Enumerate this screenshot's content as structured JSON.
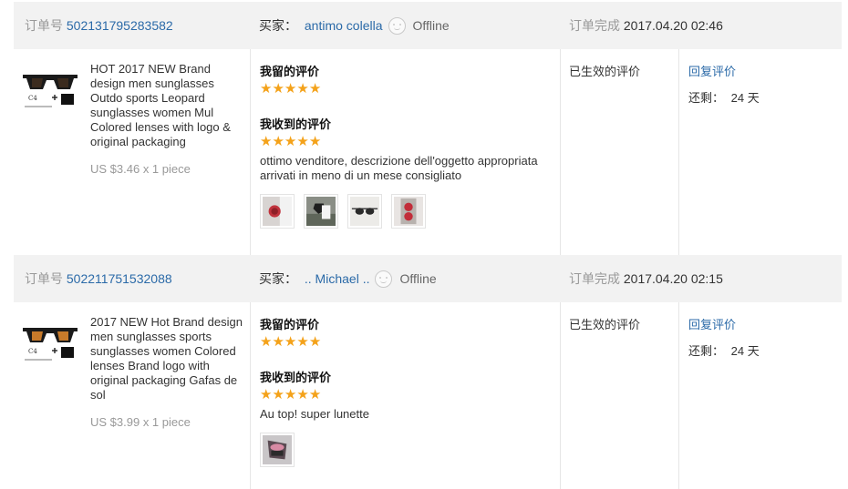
{
  "labels": {
    "order_no": "订单号",
    "buyer": "买家：",
    "completed": "订单完成",
    "my_review": "我留的评价",
    "received_review": "我收到的评价",
    "effective": "已生效的评价",
    "reply": "回复评价",
    "remaining": "还剩：",
    "offline": "Offline"
  },
  "orders": [
    {
      "order_no": "502131795283582",
      "buyer": "antimo colella",
      "status": "Offline",
      "completed_time": "2017.04.20 02:46",
      "product_title": "HOT 2017 NEW Brand design men sunglasses Outdo sports Leopard sunglasses women Mul Colored lenses with logo & original packaging",
      "price": "US $3.46 x 1 piece",
      "my_rating": 5,
      "received_rating": 5,
      "comment": "ottimo venditore, descrizione dell'oggetto appropriata arrivati in meno di un mese consigliato",
      "remaining": "24 天"
    },
    {
      "order_no": "502211751532088",
      "buyer": ".. Michael ..",
      "status": "Offline",
      "completed_time": "2017.04.20 02:15",
      "product_title": "2017 NEW Hot Brand design men sunglasses sports sunglasses women Colored lenses Brand logo with original packaging Gafas de sol",
      "price": "US $3.99 x 1 piece",
      "my_rating": 5,
      "received_rating": 5,
      "comment": "Au top! super lunette",
      "remaining": "24 天"
    }
  ],
  "colors": {
    "accent_link": "#2b6aa8",
    "star": "#f4a21a",
    "header_bg": "#f2f2f2",
    "muted": "#999999"
  },
  "icons": [
    "offline-face-icon",
    "star-icon",
    "sunglasses-thumbnail"
  ]
}
